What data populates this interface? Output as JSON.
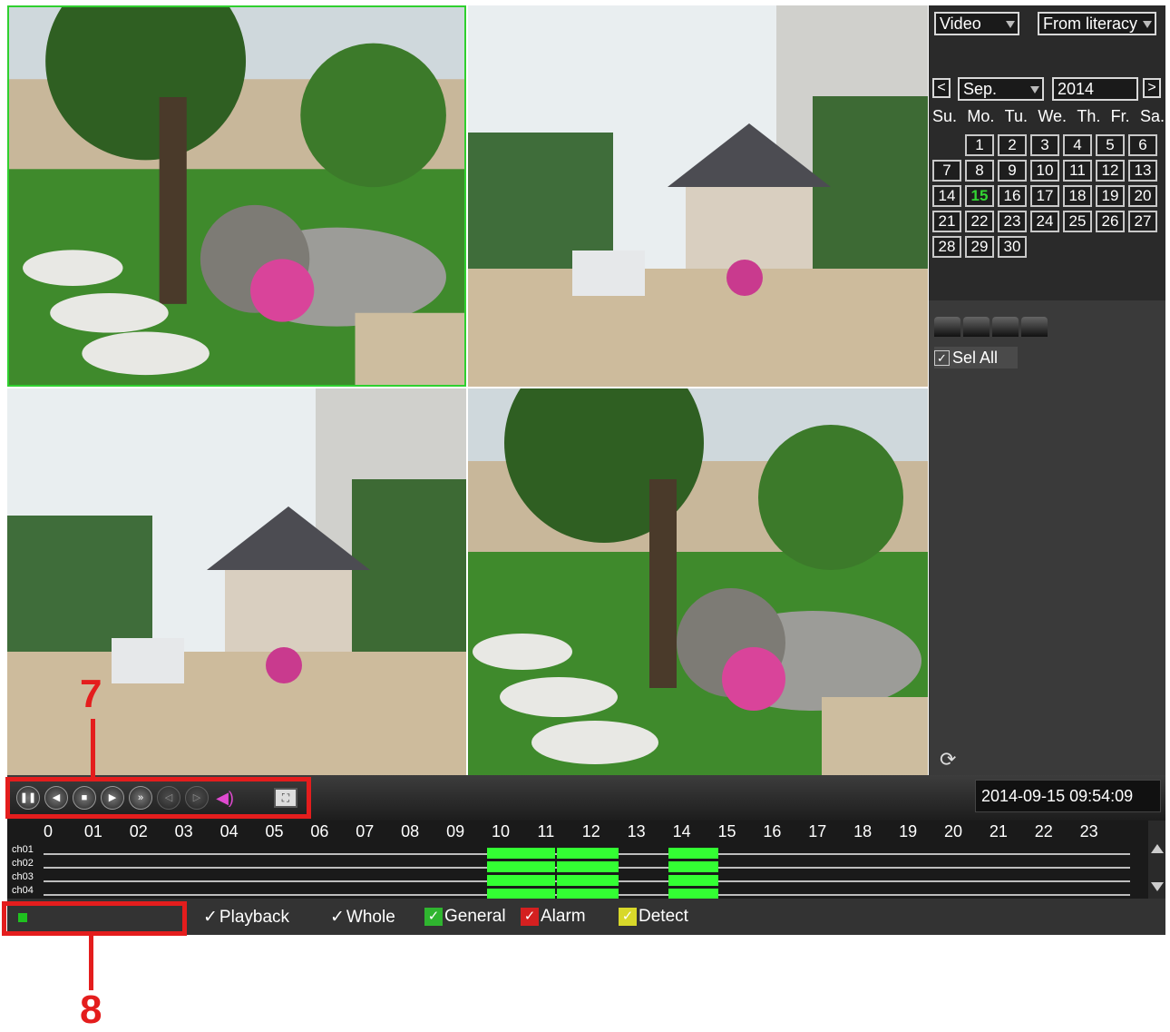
{
  "filters": {
    "type_value": "Video",
    "source_value": "From literacy"
  },
  "calendar": {
    "prev_label": "<",
    "next_label": ">",
    "month_value": "Sep.",
    "year_value": "2014",
    "weekdays": [
      "Su.",
      "Mo.",
      "Tu.",
      "We.",
      "Th.",
      "Fr.",
      "Sa."
    ],
    "days": [
      "1",
      "2",
      "3",
      "4",
      "5",
      "6",
      "7",
      "8",
      "9",
      "10",
      "11",
      "12",
      "13",
      "14",
      "15",
      "16",
      "17",
      "18",
      "19",
      "20",
      "21",
      "22",
      "23",
      "24",
      "25",
      "26",
      "27",
      "28",
      "29",
      "30"
    ],
    "selected_day": "15"
  },
  "channel_select": {
    "sel_all_label": "Sel All",
    "sel_all_checked": true
  },
  "playback": {
    "datetime": "2014-09-15 09:54:09",
    "buttons": [
      "pause",
      "slow-backward",
      "stop",
      "play",
      "fast-forward",
      "prev-frame",
      "next-frame",
      "volume",
      "fullscreen"
    ]
  },
  "timeline": {
    "hours": [
      "0",
      "01",
      "02",
      "03",
      "04",
      "05",
      "06",
      "07",
      "08",
      "09",
      "10",
      "11",
      "12",
      "13",
      "14",
      "15",
      "16",
      "17",
      "18",
      "19",
      "20",
      "21",
      "22",
      "23"
    ],
    "channels": [
      "ch01",
      "ch02",
      "ch03",
      "ch04"
    ],
    "record_color": "#33ff33",
    "record_segments_hours": [
      [
        9.7,
        11.2
      ],
      [
        11.25,
        12.6
      ],
      [
        13.7,
        14.8
      ]
    ]
  },
  "legend": {
    "playback_label": "Playback",
    "whole_label": "Whole",
    "general_label": "General",
    "alarm_label": "Alarm",
    "detect_label": "Detect",
    "general_color": "#2fb52f",
    "alarm_color": "#d42020",
    "detect_color": "#d8d82a",
    "check_mark": "✓"
  },
  "annotations": {
    "label_7": "7",
    "label_8": "8",
    "color": "#e41d1d"
  }
}
